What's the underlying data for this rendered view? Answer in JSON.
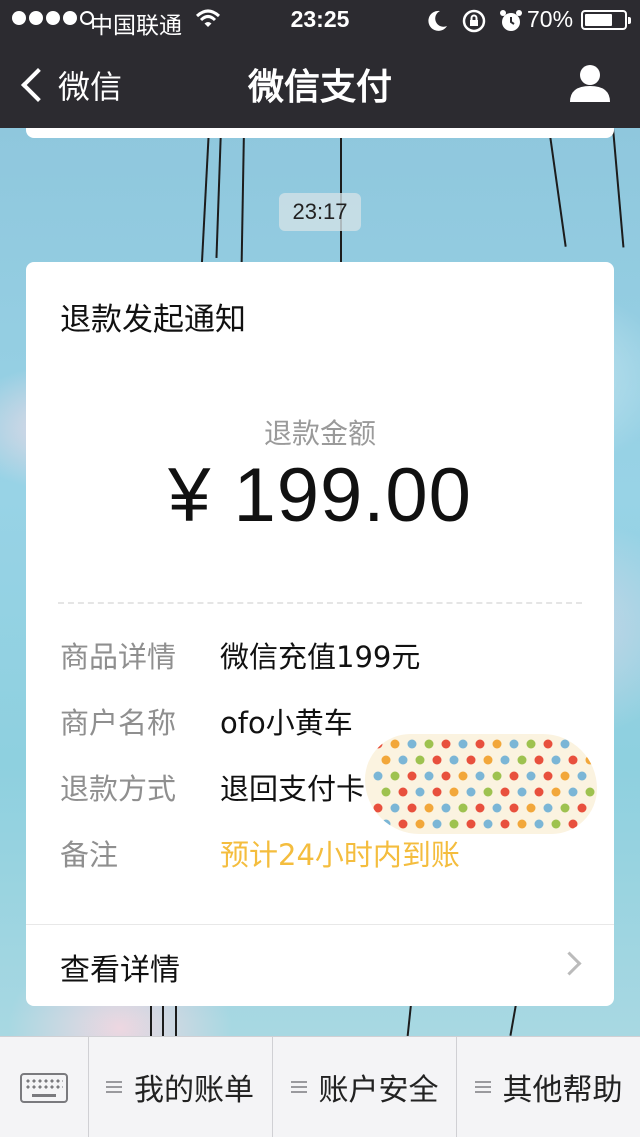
{
  "status_bar": {
    "carrier": "中国联通",
    "time": "23:25",
    "battery_pct": "70%",
    "battery_level": 0.7,
    "signal_bars": 5,
    "signal_filled": 4
  },
  "nav": {
    "back_label": "微信",
    "title": "微信支付"
  },
  "chat": {
    "timestamp": "23:17"
  },
  "card": {
    "title": "退款发起通知",
    "amount_label": "退款金额",
    "amount": "¥ 199.00",
    "rows": [
      {
        "key": "商品详情",
        "value": "微信充值199元"
      },
      {
        "key": "商户名称",
        "value": "ofo小黄车"
      },
      {
        "key": "退款方式",
        "value": "退回支付卡("
      },
      {
        "key": "备注",
        "value": "预计24小时内到账"
      }
    ],
    "detail_label": "查看详情",
    "note_color": "#f4bd3e"
  },
  "bottom_menu": {
    "items": [
      {
        "label": "我的账单"
      },
      {
        "label": "账户安全"
      },
      {
        "label": "其他帮助"
      }
    ]
  },
  "colors": {
    "topbar": "#2c2b30",
    "accent_orange": "#f4bd3e"
  }
}
